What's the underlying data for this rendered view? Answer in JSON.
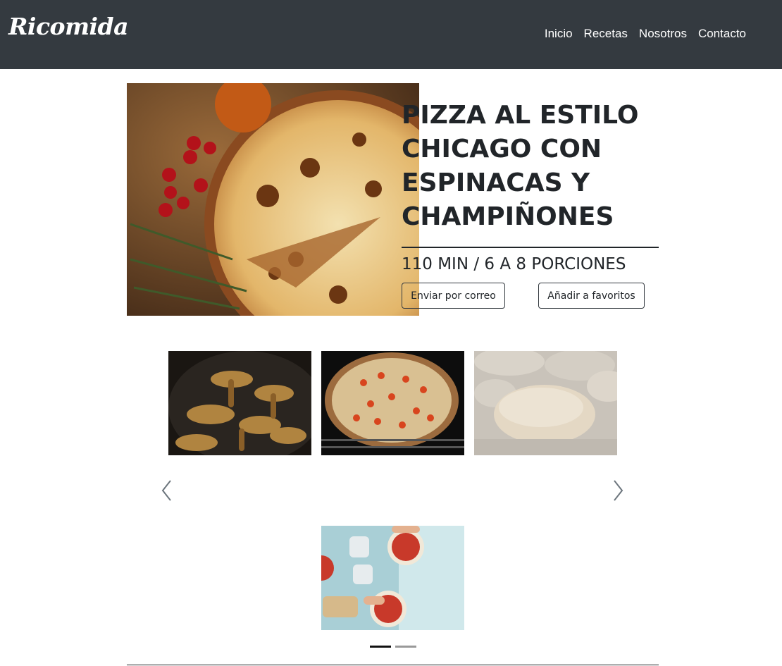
{
  "header": {
    "brand": "Ricomida",
    "nav": [
      "Inicio",
      "Recetas",
      "Nosotros",
      "Contacto"
    ]
  },
  "hero": {
    "title": "PIZZA AL ESTILO CHICAGO CON ESPINACAS Y CHAMPIÑONES",
    "meta": "110 MIN / 6 A 8 PORCIONES",
    "email_button": "Enviar por correo",
    "favorite_button": "Añadir a favoritos"
  },
  "carousel": {
    "indicators": 2,
    "active_index": 0
  },
  "colors": {
    "navbar": "#343a40",
    "text": "#212529"
  }
}
